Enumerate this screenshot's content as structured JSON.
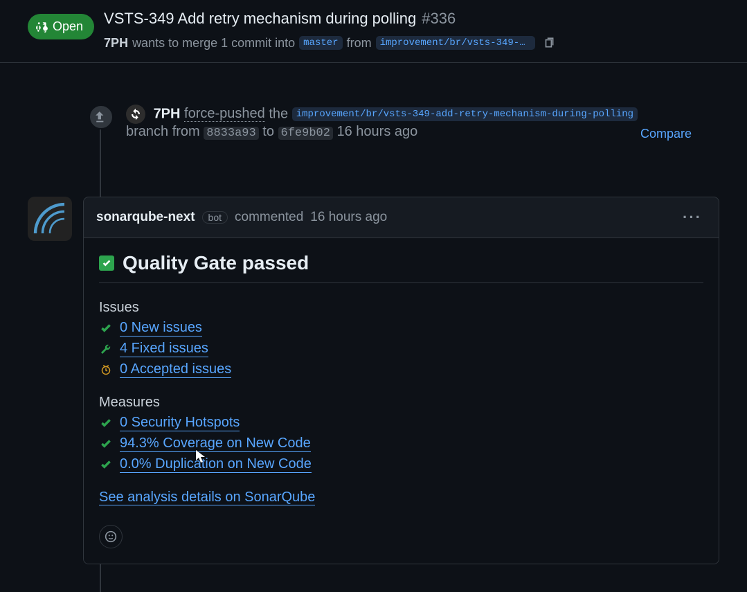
{
  "header": {
    "state": "Open",
    "title": "VSTS-349 Add retry mechanism during polling",
    "number": "#336",
    "author": "7PH",
    "wants_to_merge": "wants to merge 1 commit into",
    "base_branch": "master",
    "from_word": "from",
    "head_branch": "improvement/br/vsts-349-a…"
  },
  "event": {
    "actor": "7PH",
    "action": "force-pushed",
    "the_word": "the",
    "branch": "improvement/br/vsts-349-add-retry-mechanism-during-polling",
    "branch_word": "branch from",
    "from_sha": "8833a93",
    "to_word": "to",
    "to_sha": "6fe9b02",
    "time": "16 hours ago",
    "compare": "Compare"
  },
  "comment": {
    "author": "sonarqube-next",
    "bot_label": "bot",
    "verb": "commented",
    "time": "16 hours ago",
    "qg_heading": "Quality Gate passed",
    "issues_heading": "Issues",
    "issues": [
      {
        "icon": "check",
        "text": "0 New issues"
      },
      {
        "icon": "wrench",
        "text": "4 Fixed issues"
      },
      {
        "icon": "clock",
        "text": "0 Accepted issues"
      }
    ],
    "measures_heading": "Measures",
    "measures": [
      {
        "icon": "check",
        "text": "0 Security Hotspots"
      },
      {
        "icon": "check",
        "text": "94.3% Coverage on New Code"
      },
      {
        "icon": "check",
        "text": "0.0% Duplication on New Code"
      }
    ],
    "details_link": "See analysis details on SonarQube"
  }
}
